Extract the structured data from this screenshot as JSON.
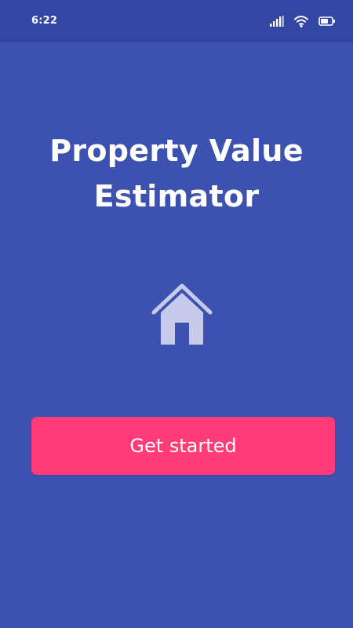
{
  "status_bar": {
    "time": "6:22",
    "icons": [
      "signal-icon",
      "wifi-icon",
      "battery-icon"
    ]
  },
  "main": {
    "title_line_1": "Property Value",
    "title_line_2": "Estimator",
    "hero_icon": "house-icon",
    "cta_label": "Get started"
  },
  "colors": {
    "background": "#3d51b0",
    "status_bar": "#3446a3",
    "accent": "#ff3b7a",
    "icon_tint": "#c7cbe9",
    "text": "#ffffff"
  }
}
